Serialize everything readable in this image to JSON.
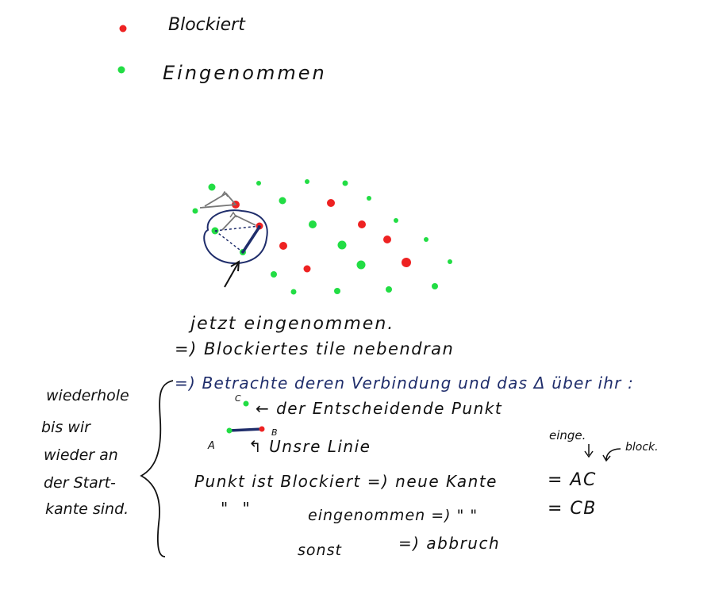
{
  "colors": {
    "blocked": "#ee2222",
    "taken": "#22dd44",
    "ink": "#111111",
    "blue_ink": "#1f2d6b",
    "grey_ink": "#777777"
  },
  "legend": {
    "blocked_label": "Blockiert",
    "taken_label": "Eingenommen"
  },
  "diagram": {
    "arrow_note": "jetzt eingenommen.",
    "note_blocked_tile": "=) Blockiertes tile nebendran",
    "instruction": "=) Betrachte deren Verbindung und das Δ über ihr :",
    "point_c_label": "C",
    "point_c_note": "← der Entscheidende Punkt",
    "point_a_label": "A",
    "point_b_label": "B",
    "line_note": "↰ Unsre Linie"
  },
  "side_note": {
    "lines": [
      "wiederhole",
      "bis wir",
      "wieder an",
      "der Start-",
      "kante sind."
    ]
  },
  "rules": {
    "header_taken": "einge.",
    "header_blocked": "block.",
    "row1": {
      "left": "Punkt ist Blockiert =) neue Kante",
      "right": "= AC"
    },
    "row2": {
      "ditto": "\"   \"",
      "middle": "eingenommen =)  \"     \"",
      "right": "= CB"
    },
    "row3": {
      "left": "sonst",
      "right": "=) abbruch"
    }
  }
}
